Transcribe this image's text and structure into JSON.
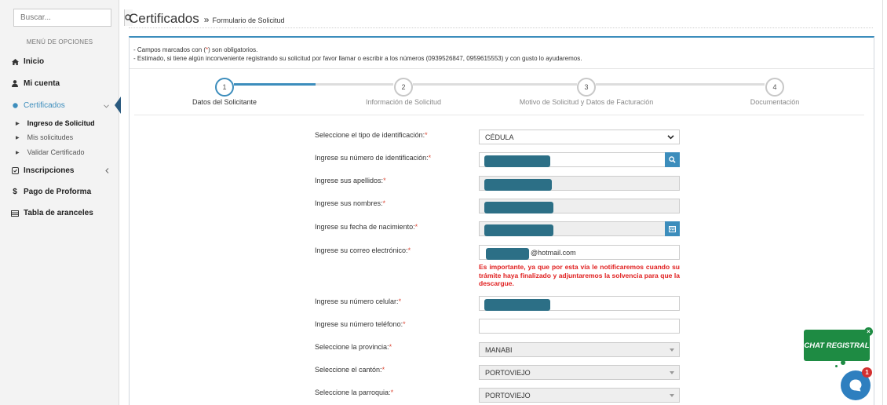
{
  "sidebar": {
    "search_placeholder": "Buscar...",
    "menu_title": "MENÚ DE OPCIONES",
    "items": [
      {
        "label": "Inicio",
        "icon": "home-icon"
      },
      {
        "label": "Mi cuenta",
        "icon": "user-icon"
      },
      {
        "label": "Certificados",
        "icon": "circle-icon"
      },
      {
        "label": "Inscripciones",
        "icon": "register-icon"
      },
      {
        "label": "Pago de Proforma",
        "icon": "dollar-icon"
      },
      {
        "label": "Tabla de aranceles",
        "icon": "table-icon"
      }
    ],
    "sub_items": [
      {
        "label": "Ingreso de Solicitud"
      },
      {
        "label": "Mis solicitudes"
      },
      {
        "label": "Validar Certificado"
      }
    ]
  },
  "header": {
    "title": "Certificados",
    "separator": "»",
    "breadcrumb": "Formulario de Solicitud"
  },
  "notes": {
    "line1_pre": "- Campos marcados con (",
    "line1_star": "*",
    "line1_post": ") son obligatorios.",
    "line2": "- Estimado, si tiene algún inconveniente registrando su solicitud por favor llamar o escribir a los números (0939526847, 0959615553) y con gusto lo ayudaremos."
  },
  "steps": [
    {
      "number": "1",
      "label": "Datos del Solicitante"
    },
    {
      "number": "2",
      "label": "Información de Solicitud"
    },
    {
      "number": "3",
      "label": "Motivo de Solicitud y Datos de Facturación"
    },
    {
      "number": "4",
      "label": "Documentación"
    }
  ],
  "form": {
    "required_mark": "*",
    "id_type_label": "Seleccione el tipo de identificación:",
    "id_type_value": "CÉDULA",
    "id_number_label": "Ingrese su número de identificación:",
    "surnames_label": "Ingrese sus apellidos:",
    "names_label": "Ingrese sus nombres:",
    "birthdate_label": "Ingrese su fecha de nacimiento:",
    "email_label": "Ingrese su correo electrónico:",
    "email_domain": "@hotmail.com",
    "email_note": "Es importante, ya que por esta vía le notificaremos cuando su trámite haya finalizado y adjuntaremos la solvencia para que la descargue.",
    "mobile_label": "Ingrese su número celular:",
    "phone_label": "Ingrese su número teléfono:",
    "province_label": "Seleccione la provincia:",
    "province_value": "MANABI",
    "canton_label": "Seleccione el cantón:",
    "canton_value": "PORTOVIEJO",
    "parish_label": "Seleccione la parroquia:",
    "parish_value": "PORTOVIEJO"
  },
  "chat": {
    "label": "CHAT REGISTRAL",
    "close": "×",
    "badge": "1"
  },
  "colors": {
    "accent": "#3c8dbc",
    "required": "#dd4b39",
    "chat_green": "#1e8b43"
  }
}
